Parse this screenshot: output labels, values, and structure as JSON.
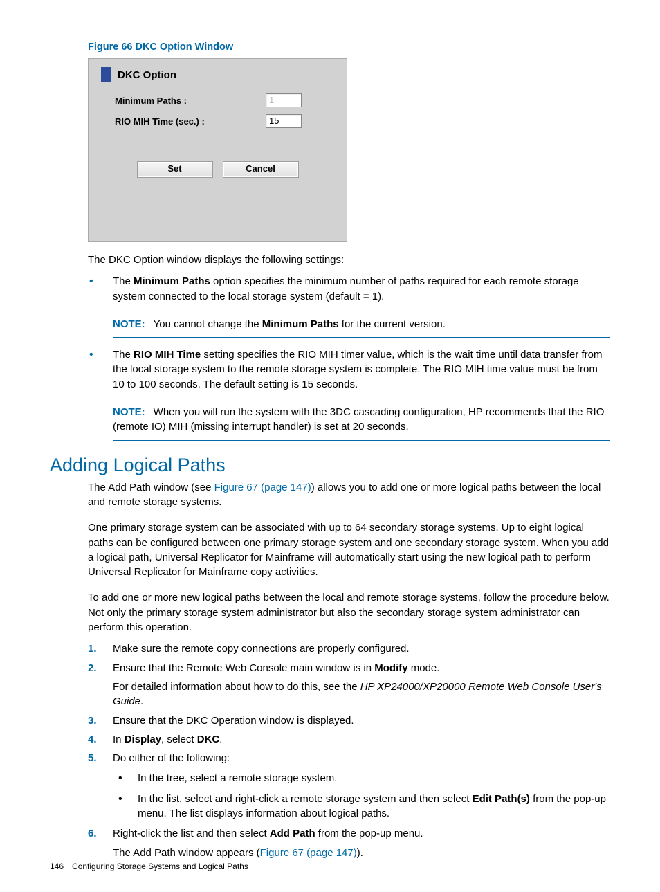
{
  "figure_caption": "Figure 66 DKC Option Window",
  "dkc_window": {
    "title": "DKC Option",
    "min_paths_label": "Minimum Paths :",
    "min_paths_value": "1",
    "rio_mih_label": "RIO MIH Time (sec.) :",
    "rio_mih_value": "15",
    "set_btn": "Set",
    "cancel_btn": "Cancel"
  },
  "intro_text": "The DKC Option window displays the following settings:",
  "bullets": {
    "b1_pre": "The ",
    "b1_bold": "Minimum Paths",
    "b1_post": " option specifies the minimum number of paths required for each remote storage system connected to the local storage system (default = 1).",
    "b1_note_pre": "You cannot change the ",
    "b1_note_bold": "Minimum Paths",
    "b1_note_post": " for the current version.",
    "b2_pre": "The ",
    "b2_bold": "RIO MIH Time",
    "b2_post": " setting specifies the RIO MIH timer value, which is the wait time until data transfer from the local storage system to the remote storage system is complete. The RIO MIH time value must be from 10 to 100 seconds. The default setting is 15 seconds.",
    "b2_note": "When you will run the system with the 3DC cascading configuration, HP recommends that the RIO (remote IO) MIH (missing interrupt handler) is set at 20 seconds."
  },
  "note_label": "NOTE:",
  "section_heading": "Adding Logical Paths",
  "para1_pre": "The Add Path window (see ",
  "figure67_link": "Figure 67 (page 147)",
  "para1_post": ") allows you to add one or more logical paths between the local and remote storage systems.",
  "para2": "One primary storage system can be associated with up to 64 secondary storage systems. Up to eight logical paths can be configured between one primary storage system and one secondary storage system. When you add a logical path, Universal Replicator for Mainframe will automatically start using the new logical path to perform Universal Replicator for Mainframe copy activities.",
  "para3": "To add one or more new logical paths between the local and remote storage systems, follow the procedure below. Not only the primary storage system administrator but also the secondary storage system administrator can perform this operation.",
  "steps": {
    "s1": "Make sure the remote copy connections are properly configured.",
    "s2_pre": "Ensure that the Remote Web Console main window is in ",
    "s2_bold": "Modify",
    "s2_post": " mode.",
    "s2b_pre": "For detailed information about how to do this, see the ",
    "s2b_italic": "HP XP24000/XP20000 Remote Web Console User's Guide",
    "s2b_post": ".",
    "s3": "Ensure that the DKC Operation window is displayed.",
    "s4_pre": "In ",
    "s4_bold1": "Display",
    "s4_mid": ", select ",
    "s4_bold2": "DKC",
    "s4_post": ".",
    "s5": "Do either of the following:",
    "s5_sub1": "In the tree, select a remote storage system.",
    "s5_sub2_pre": "In the list, select and right-click a remote storage system and then select ",
    "s5_sub2_bold": "Edit Path(s)",
    "s5_sub2_post": " from the pop-up menu. The list displays information about logical paths.",
    "s6_pre": "Right-click the list and then select ",
    "s6_bold": "Add Path",
    "s6_post": " from the pop-up menu.",
    "s6b_pre": "The Add Path window appears (",
    "s6b_post": ")."
  },
  "footer": {
    "page_num": "146",
    "chapter": "Configuring Storage Systems and Logical Paths"
  }
}
